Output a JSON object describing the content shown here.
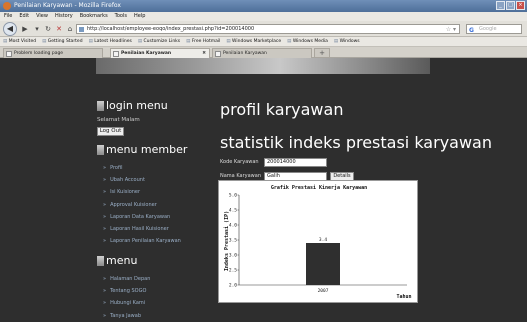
{
  "window": {
    "title": "Penilaian Karyawan - Mozilla Firefox"
  },
  "menubar": [
    "File",
    "Edit",
    "View",
    "History",
    "Bookmarks",
    "Tools",
    "Help"
  ],
  "navbar": {
    "url": "http://localhost/employee-eoqo/index_prestasi.php?id=200014000",
    "search_placeholder": "Google"
  },
  "bookmarks": [
    "Most Visited",
    "Getting Started",
    "Latest Headlines",
    "Customize Links",
    "Free Hotmail",
    "Windows Marketplace",
    "Windows Media",
    "Windows"
  ],
  "tabs": [
    {
      "label": "Problem loading page",
      "active": false
    },
    {
      "label": "Penilaian Karyawan",
      "active": true
    },
    {
      "label": "Penilaian Karyawan",
      "active": false
    }
  ],
  "sidebar": {
    "login_heading": "login menu",
    "greeting": "Selamat Malam",
    "logout_label": "Log Out",
    "member_heading": "menu member",
    "member_items": [
      "Profil",
      "Ubah Account",
      "Isi Kuisioner",
      "Approval Kuisioner",
      "Laporan Data Karyawan",
      "Laporan Hasil Kuisioner",
      "Laporan Penilaian Karyawan"
    ],
    "menu_heading": "menu",
    "menu_items": [
      "Halaman Depan",
      "Tentang SOGO",
      "Hubungi Kami",
      "Tanya Jawab"
    ]
  },
  "main": {
    "title": "profil karyawan",
    "subtitle": "statistik indeks prestasi karyawan",
    "kode_label": "Kode Karyawan",
    "kode_value": "200014000",
    "nama_label": "Nama Karyawan",
    "nama_value": "Galih",
    "details_label": "Details"
  },
  "chart_data": {
    "type": "bar",
    "title": "Grafik Prestasi Kinerja Karyawan",
    "xlabel": "Tahun",
    "ylabel": "Indeks Prestasi (IP)",
    "categories": [
      "2007"
    ],
    "values": [
      3.4
    ],
    "data_labels": [
      "3.4"
    ],
    "ylim": [
      2.0,
      5.0
    ],
    "yticks": [
      "2.0",
      "2.5",
      "3.0",
      "3.5",
      "4.0",
      "4.5",
      "5.0"
    ],
    "bar_color": "#2f2f2f",
    "grid": false
  }
}
